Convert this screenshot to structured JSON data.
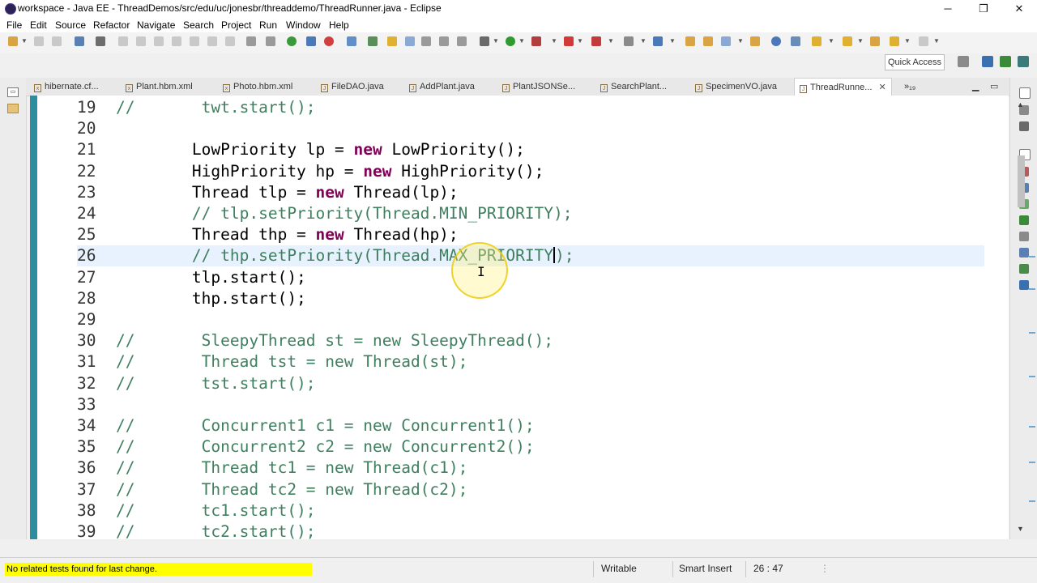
{
  "window": {
    "title": "workspace - Java EE - ThreadDemos/src/edu/uc/jonesbr/threaddemo/ThreadRunner.java - Eclipse",
    "minimize": "─",
    "restore": "❐",
    "close": "✕"
  },
  "menu": [
    "File",
    "Edit",
    "Source",
    "Refactor",
    "Navigate",
    "Search",
    "Project",
    "Run",
    "Window",
    "Help"
  ],
  "quick_access": "Quick Access",
  "tabs": [
    {
      "label": "hibernate.cf...",
      "icon": "x"
    },
    {
      "label": "Plant.hbm.xml",
      "icon": "x"
    },
    {
      "label": "Photo.hbm.xml",
      "icon": "x"
    },
    {
      "label": "FileDAO.java",
      "icon": "J"
    },
    {
      "label": "AddPlant.java",
      "icon": "J"
    },
    {
      "label": "PlantJSONSe...",
      "icon": "J"
    },
    {
      "label": "SearchPlant...",
      "icon": "J"
    },
    {
      "label": "SpecimenVO.java",
      "icon": "J"
    },
    {
      "label": "ThreadRunne...",
      "icon": "J",
      "active": true
    }
  ],
  "tab_overflow": "»₁₉",
  "tab_close": "✕",
  "code": [
    {
      "n": "19",
      "parts": [
        [
          "cm",
          "//       twt.start();"
        ]
      ]
    },
    {
      "n": "20",
      "parts": []
    },
    {
      "n": "21",
      "parts": [
        [
          "",
          "        LowPriority lp = "
        ],
        [
          "kw",
          "new"
        ],
        [
          "",
          " LowPriority();"
        ]
      ]
    },
    {
      "n": "22",
      "parts": [
        [
          "",
          "        HighPriority hp = "
        ],
        [
          "kw",
          "new"
        ],
        [
          "",
          " HighPriority();"
        ]
      ]
    },
    {
      "n": "23",
      "parts": [
        [
          "",
          "        Thread tlp = "
        ],
        [
          "kw",
          "new"
        ],
        [
          "",
          " Thread(lp);"
        ]
      ]
    },
    {
      "n": "24",
      "parts": [
        [
          "cm",
          "        // tlp.setPriority(Thread.MIN_PRIORITY);"
        ]
      ]
    },
    {
      "n": "25",
      "parts": [
        [
          "",
          "        Thread thp = "
        ],
        [
          "kw",
          "new"
        ],
        [
          "",
          " Thread(hp);"
        ]
      ]
    },
    {
      "n": "26",
      "current": true,
      "parts": [
        [
          "cm",
          "        // thp.setPriority(Thread.MAX_PRIORITY"
        ],
        [
          "caret",
          ""
        ],
        [
          "cm",
          ");"
        ]
      ]
    },
    {
      "n": "27",
      "parts": [
        [
          "",
          "        tlp.start();"
        ]
      ]
    },
    {
      "n": "28",
      "parts": [
        [
          "",
          "        thp.start();"
        ]
      ]
    },
    {
      "n": "29",
      "parts": []
    },
    {
      "n": "30",
      "parts": [
        [
          "cm",
          "//       SleepyThread st = new SleepyThread();"
        ]
      ]
    },
    {
      "n": "31",
      "parts": [
        [
          "cm",
          "//       Thread tst = new Thread(st);"
        ]
      ]
    },
    {
      "n": "32",
      "parts": [
        [
          "cm",
          "//       tst.start();"
        ]
      ]
    },
    {
      "n": "33",
      "parts": []
    },
    {
      "n": "34",
      "parts": [
        [
          "cm",
          "//       Concurrent1 c1 = new Concurrent1();"
        ]
      ]
    },
    {
      "n": "35",
      "parts": [
        [
          "cm",
          "//       Concurrent2 c2 = new Concurrent2();"
        ]
      ]
    },
    {
      "n": "36",
      "parts": [
        [
          "cm",
          "//       Thread tc1 = new Thread(c1);"
        ]
      ]
    },
    {
      "n": "37",
      "parts": [
        [
          "cm",
          "//       Thread tc2 = new Thread(c2);"
        ]
      ]
    },
    {
      "n": "38",
      "parts": [
        [
          "cm",
          "//       tc1.start();"
        ]
      ]
    },
    {
      "n": "39",
      "parts": [
        [
          "cm",
          "//       tc2.start();"
        ]
      ]
    }
  ],
  "status": {
    "message": "No related tests found for last change.",
    "writable": "Writable",
    "insert_mode": "Smart Insert",
    "position": "26 : 47"
  }
}
